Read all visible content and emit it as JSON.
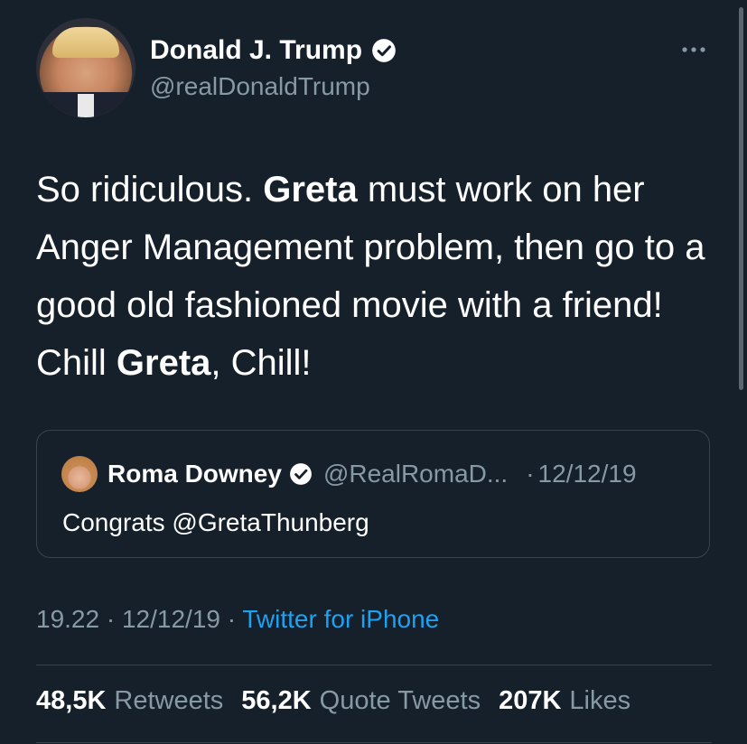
{
  "tweet": {
    "author": {
      "display_name": "Donald J. Trump",
      "handle": "@realDonaldTrump",
      "verified": true,
      "avatar_icon": "avatar-photo"
    },
    "text_segments": [
      {
        "text": "So ridiculous. ",
        "bold": false
      },
      {
        "text": "Greta",
        "bold": true
      },
      {
        "text": " must work on her Anger Management problem, then go to a good old fashioned movie with a friend! Chill ",
        "bold": false
      },
      {
        "text": "Greta",
        "bold": true
      },
      {
        "text": ", Chill!",
        "bold": false
      }
    ],
    "quoted_tweet": {
      "display_name": "Roma Downey",
      "handle": "@RealRomaD...",
      "separator": "·",
      "date": "12/12/19",
      "text": "Congrats @GretaThunberg",
      "verified": true
    },
    "timestamp": {
      "time": "19.22",
      "date": "12/12/19",
      "source": "Twitter for iPhone",
      "dot": " · "
    },
    "stats": {
      "retweets_count": "48,5K",
      "retweets_label": "Retweets",
      "quotes_count": "56,2K",
      "quotes_label": "Quote Tweets",
      "likes_count": "207K",
      "likes_label": "Likes"
    }
  },
  "colors": {
    "background": "#15202b",
    "text": "#ffffff",
    "secondary_text": "#8899a6",
    "link": "#1da1f2",
    "border": "#38444d"
  },
  "icons": {
    "verified": "verified-badge-icon",
    "more": "more-horizontal-icon"
  }
}
